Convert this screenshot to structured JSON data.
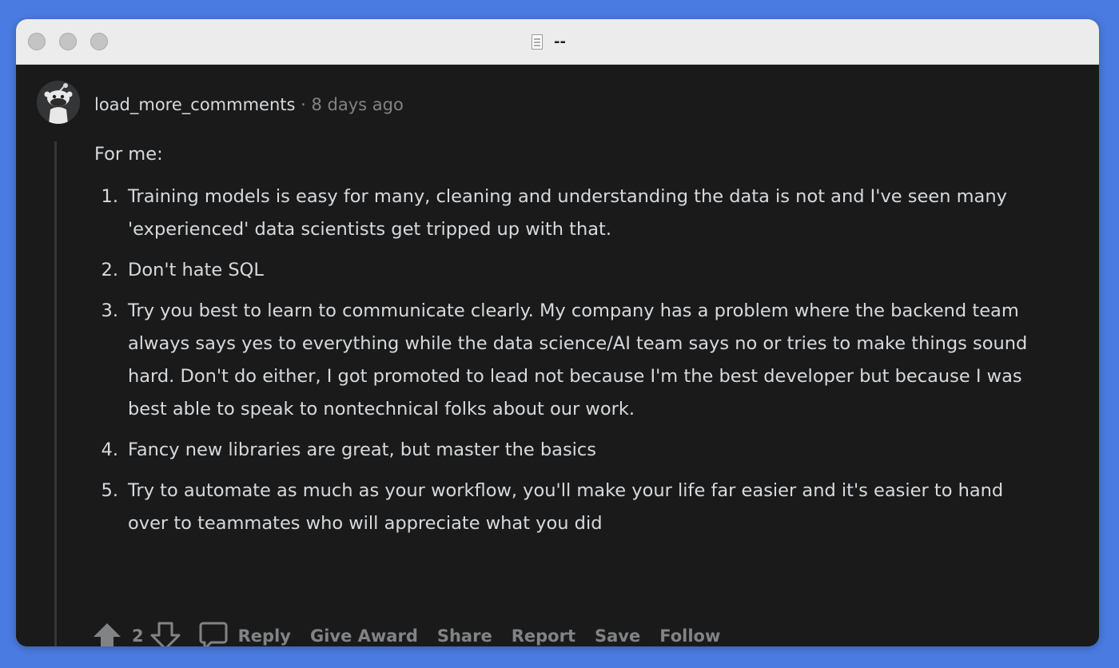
{
  "window": {
    "title": "--"
  },
  "comment": {
    "author": "load_more_commments",
    "separator": "·",
    "age": "8 days ago",
    "intro": "For me:",
    "items": [
      {
        "num": "1.",
        "text": "Training models is easy for many, cleaning and understanding the data is not and I've seen many 'experienced' data scientists get tripped up with that."
      },
      {
        "num": "2.",
        "text": "Don't hate SQL"
      },
      {
        "num": "3.",
        "text": "Try you best to learn to communicate clearly. My company has a problem where the backend team always says yes to everything while the data science/AI team says no or tries to make things sound hard. Don't do either, I got promoted to lead not because I'm the best developer but because I was best able to speak to nontechnical folks about our work."
      },
      {
        "num": "4.",
        "text": "Fancy new libraries are great, but master the basics"
      },
      {
        "num": "5.",
        "text": "Try to automate as much as your workflow, you'll make your life far easier and it's easier to hand over to teammates who will appreciate what you did"
      }
    ]
  },
  "actions": {
    "vote_count": "2",
    "reply": "Reply",
    "give_award": "Give Award",
    "share": "Share",
    "report": "Report",
    "save": "Save",
    "follow": "Follow"
  },
  "colors": {
    "background": "#4a7be0",
    "panel": "#1a1a1b",
    "text": "#d7dadc",
    "muted": "#818384"
  }
}
